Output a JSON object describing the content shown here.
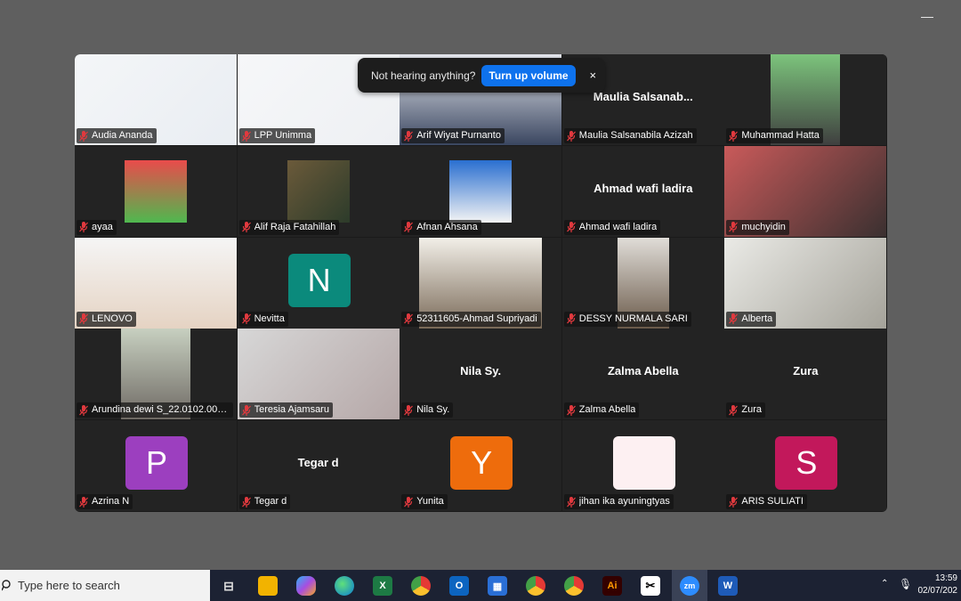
{
  "window": {
    "minimize": "—"
  },
  "notification": {
    "message": "Not hearing anything?",
    "button": "Turn up volume",
    "close": "×"
  },
  "participants": [
    {
      "name": "Audia Ananda",
      "type": "video"
    },
    {
      "name": "LPP Unimma",
      "type": "video"
    },
    {
      "name": "Arif Wiyat Purnanto",
      "type": "video",
      "active": true
    },
    {
      "name": "Maulia Salsanabila Azizah",
      "type": "name",
      "display": "Maulia  Salsanab..."
    },
    {
      "name": "Muhammad Hatta",
      "type": "video"
    },
    {
      "name": "ayaa",
      "type": "video"
    },
    {
      "name": "Alif Raja Fatahillah",
      "type": "video"
    },
    {
      "name": "Afnan Ahsana",
      "type": "video"
    },
    {
      "name": "Ahmad wafi ladira",
      "type": "name",
      "display": "Ahmad wafi ladira"
    },
    {
      "name": "muchyidin",
      "type": "video"
    },
    {
      "name": "LENOVO",
      "type": "video"
    },
    {
      "name": "Nevitta",
      "type": "avatar",
      "initial": "N",
      "color": "#0b8a7c"
    },
    {
      "name": "52311605-Ahmad Supriyadi",
      "type": "video"
    },
    {
      "name": "DESSY NURMALA SARI",
      "type": "video"
    },
    {
      "name": "Alberta",
      "type": "video"
    },
    {
      "name": "Arundina dewi S_22.0102.000...",
      "type": "video"
    },
    {
      "name": "Teresia Ajamsaru",
      "type": "video"
    },
    {
      "name": "Nila Sy.",
      "type": "name",
      "display": "Nila Sy."
    },
    {
      "name": "Zalma Abella",
      "type": "name",
      "display": "Zalma Abella"
    },
    {
      "name": "Zura",
      "type": "name",
      "display": "Zura"
    },
    {
      "name": "Azrina N",
      "type": "avatar",
      "initial": "P",
      "color": "#9c3fbf"
    },
    {
      "name": "Tegar d",
      "type": "name",
      "display": "Tegar d"
    },
    {
      "name": "Yunita",
      "type": "avatar",
      "initial": "Y",
      "color": "#ee6c0c"
    },
    {
      "name": "jihan ika ayuningtyas",
      "type": "avatar",
      "initial": "",
      "color": "#fdf0f2"
    },
    {
      "name": "ARIS SULIATI",
      "type": "avatar",
      "initial": "S",
      "color": "#c2185b"
    }
  ],
  "colors": {
    "active_speaker": "#23d964",
    "toast_button": "#0e72ed",
    "muted_icon": "#e0393e"
  },
  "taskbar": {
    "search_placeholder": "Type here to search",
    "apps": [
      "task-view",
      "file-explorer",
      "copilot",
      "edge",
      "excel",
      "chrome",
      "outlook",
      "store",
      "chrome-profile",
      "chrome-profile-2",
      "illustrator",
      "capcut",
      "zoom",
      "word"
    ],
    "time": "13:59",
    "date": "02/07/202"
  }
}
